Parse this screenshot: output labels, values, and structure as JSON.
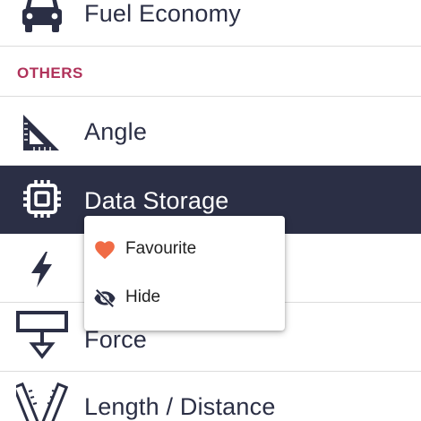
{
  "list": {
    "items_top": [
      {
        "label": "Fuel Economy",
        "icon": "car-icon"
      }
    ],
    "section": {
      "title": "OTHERS"
    },
    "items": [
      {
        "label": "Angle",
        "icon": "set-square-icon"
      },
      {
        "label": "Data Storage",
        "icon": "chip-icon",
        "selected": true
      },
      {
        "label": "",
        "icon": "lightning-bolt-icon"
      },
      {
        "label": "Force",
        "icon": "force-arrow-icon"
      },
      {
        "label": "Length / Distance",
        "icon": "ruler-icon"
      }
    ]
  },
  "context_menu": {
    "items": [
      {
        "label": "Favourite",
        "icon": "heart-icon"
      },
      {
        "label": "Hide",
        "icon": "eye-off-icon"
      }
    ]
  },
  "colors": {
    "primary_dark": "#2b2f45",
    "section_header": "#b0325a",
    "favourite_heart": "#f06b45",
    "divider": "#dcdcdc"
  }
}
